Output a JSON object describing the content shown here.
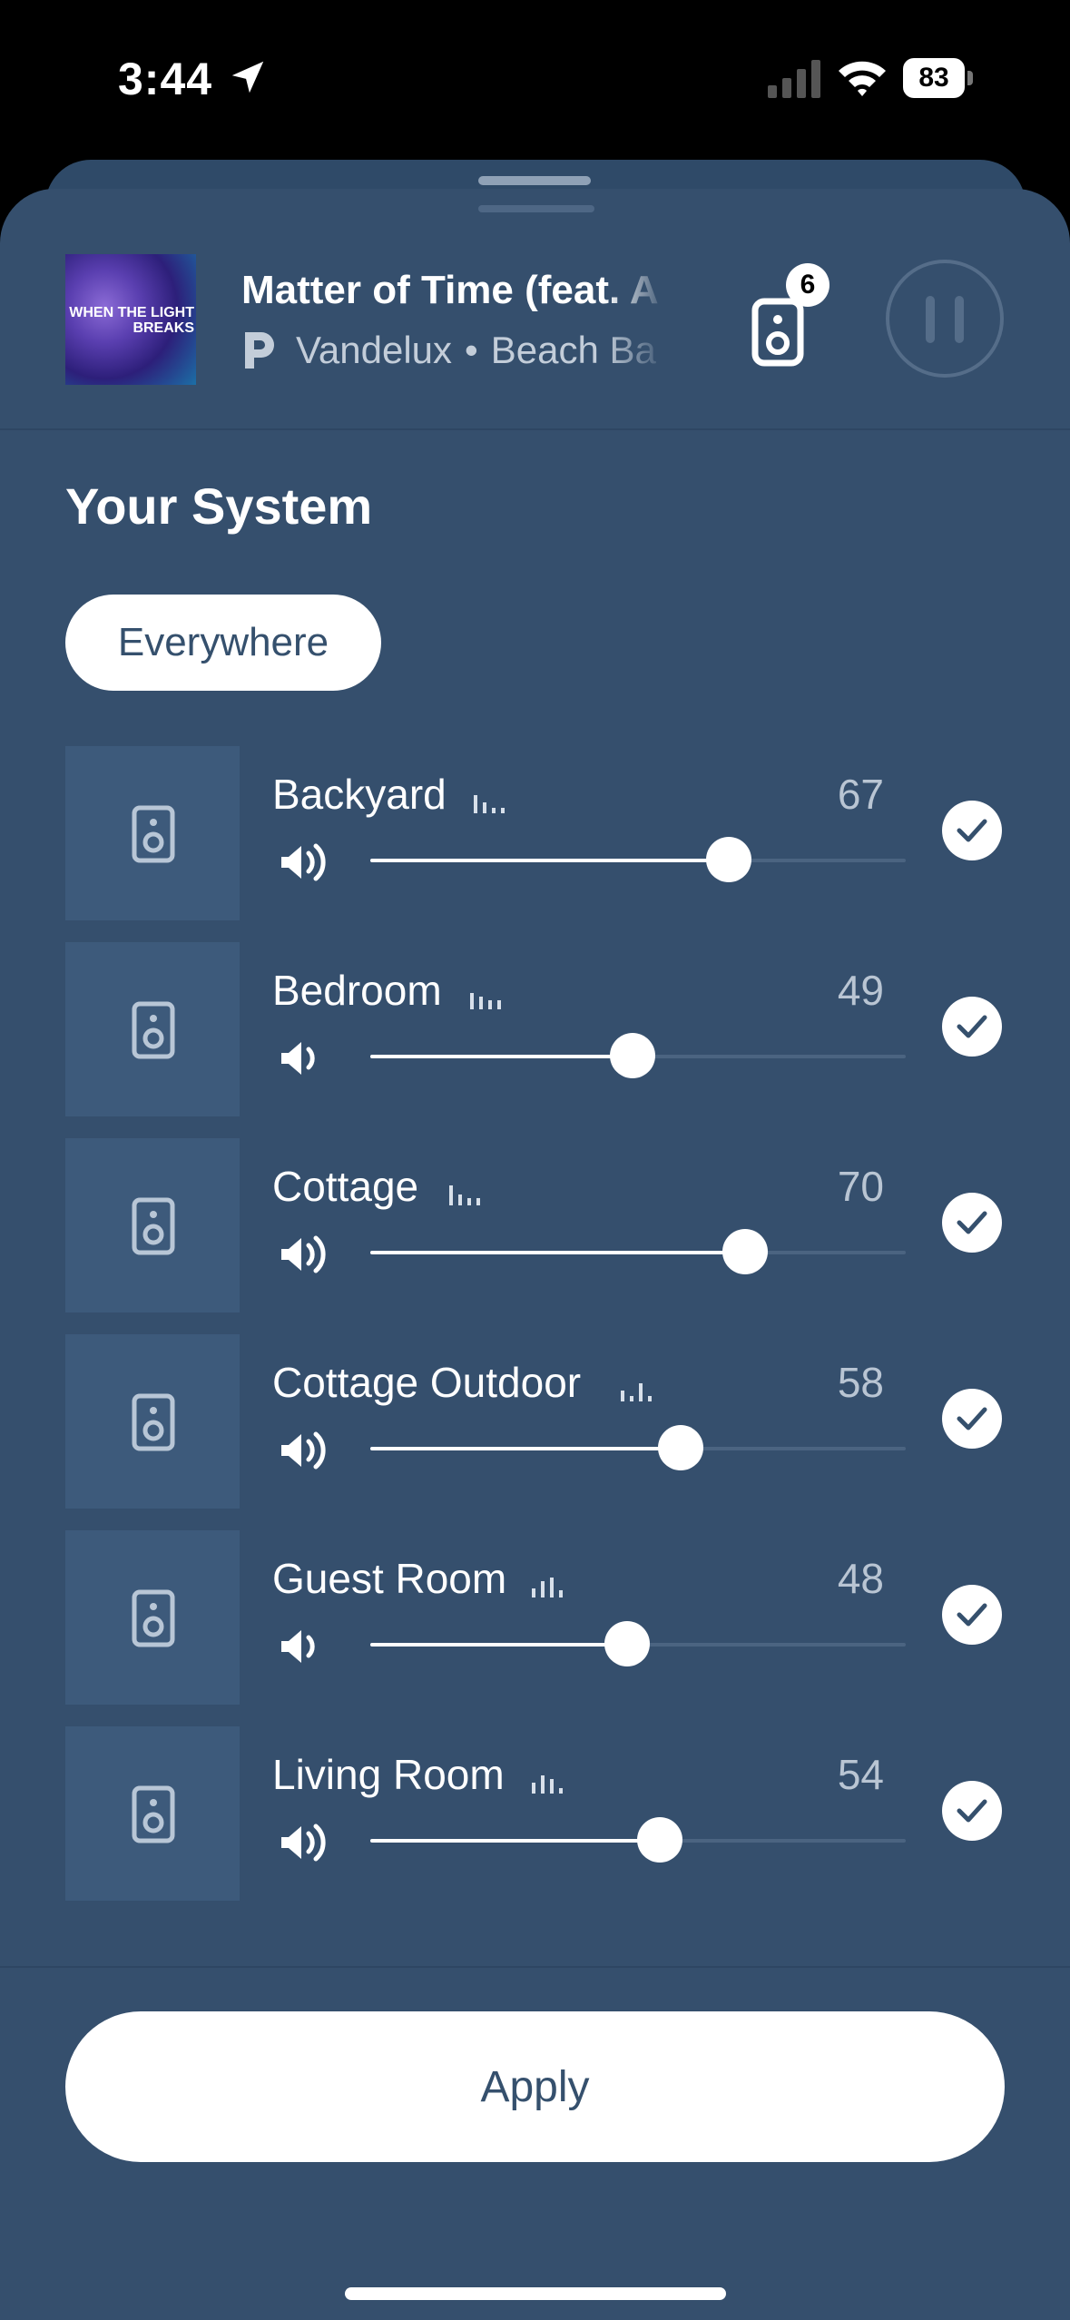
{
  "status": {
    "time": "3:44",
    "battery": "83"
  },
  "now_playing": {
    "album_art_text": "WHEN THE LIGHT BREAKS",
    "title": "Matter of Time (feat. A",
    "artist": "Vandelux",
    "separator": "•",
    "album": "Beach Ba",
    "speaker_count": "6",
    "service_icon": "pandora-icon"
  },
  "system": {
    "title": "Your System",
    "group_chip": "Everywhere"
  },
  "rooms": [
    {
      "name": "Backyard",
      "volume": "67",
      "level": 0.67
    },
    {
      "name": "Bedroom",
      "volume": "49",
      "level": 0.49
    },
    {
      "name": "Cottage",
      "volume": "70",
      "level": 0.7
    },
    {
      "name": "Cottage Outdoor",
      "volume": "58",
      "level": 0.58
    },
    {
      "name": "Guest Room",
      "volume": "48",
      "level": 0.48
    },
    {
      "name": "Living Room",
      "volume": "54",
      "level": 0.54
    }
  ],
  "apply_label": "Apply",
  "colors": {
    "sheet": "#354f6d",
    "tile": "#3d5a7b",
    "accent_text": "#35506d"
  }
}
